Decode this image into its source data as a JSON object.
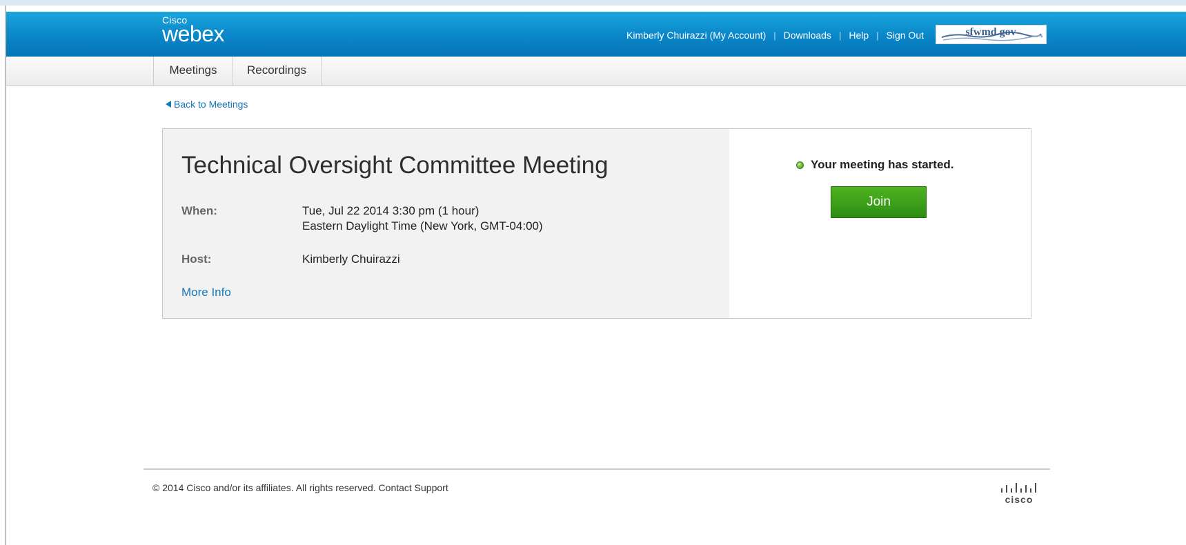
{
  "header": {
    "logo_small": "Cisco",
    "logo_large": "webex",
    "account_link": "Kimberly Chuirazzi (My Account)",
    "downloads_link": "Downloads",
    "help_link": "Help",
    "signout_link": "Sign Out",
    "separator": "|",
    "org_logo_text": "sfwmd.gov"
  },
  "nav": {
    "tabs": [
      {
        "label": "Meetings"
      },
      {
        "label": "Recordings"
      }
    ]
  },
  "back_link": "Back to Meetings",
  "meeting": {
    "title": "Technical Oversight Committee Meeting",
    "when_label": "When:",
    "when_line1": "Tue, Jul 22 2014 3:30 pm (1 hour)",
    "when_line2": "Eastern Daylight Time (New York, GMT-04:00)",
    "host_label": "Host:",
    "host_value": "Kimberly Chuirazzi",
    "more_info": "More Info"
  },
  "status": {
    "text": "Your meeting has started.",
    "indicator_color": "#5aa82a"
  },
  "join_button": {
    "label": "Join",
    "color": "#3a9d19"
  },
  "footer": {
    "copyright": "© 2014 Cisco and/or its affiliates. All rights reserved.",
    "contact_link": "Contact Support",
    "brand_logo": "cisco"
  },
  "colors": {
    "header_blue": "#0a86c8",
    "link_blue": "#1577b6"
  }
}
